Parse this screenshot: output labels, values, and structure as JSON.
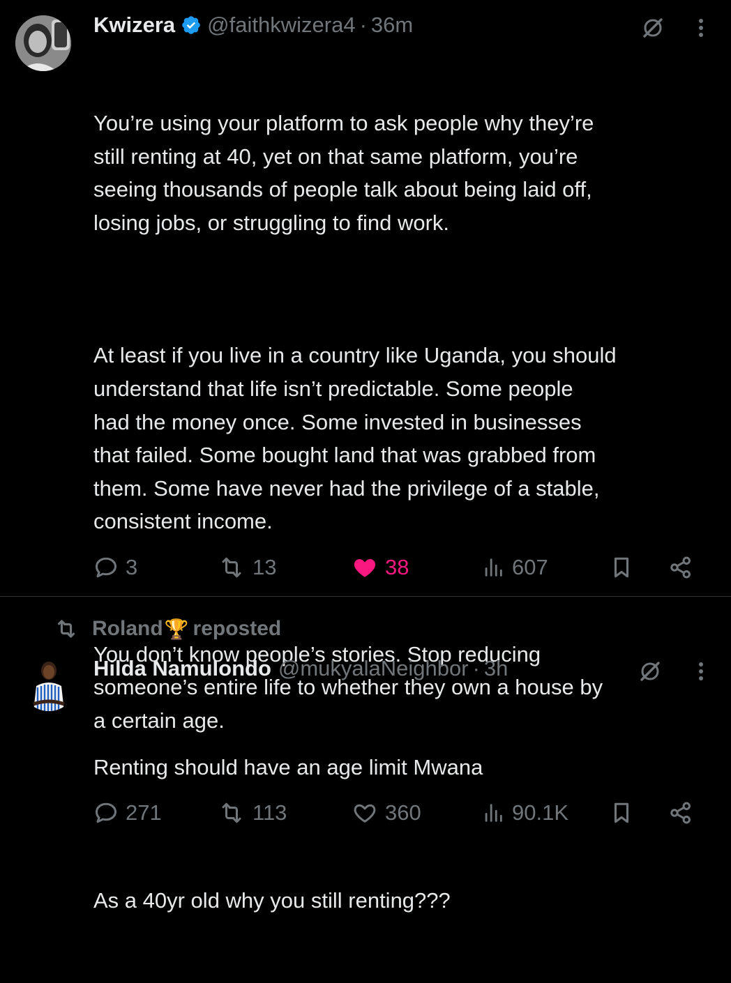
{
  "tweet1": {
    "display_name": "Kwizera",
    "handle": "@faithkwizera4",
    "separator": "·",
    "time": "36m",
    "paragraphs": [
      "You’re using your platform to ask people why they’re\nstill renting at 40, yet on that same platform, you’re\nseeing thousands of people talk about being laid off,\nlosing jobs, or struggling to find work.",
      "At least if you live in a country like Uganda, you should\nunderstand that life isn’t predictable. Some people\nhad the money once. Some invested in businesses\nthat failed. Some bought land that was grabbed from\nthem. Some have never had the privilege of a stable,\nconsistent income.",
      "You don’t know people’s stories. Stop reducing\nsomeone’s entire life to whether they own a house by\na certain age."
    ],
    "replies": "3",
    "reposts": "13",
    "likes": "38",
    "views": "607",
    "liked": true
  },
  "repost_context": {
    "user": "Roland",
    "emoji": "🏆",
    "label": "reposted"
  },
  "tweet2": {
    "display_name": "Hilda Namulondo",
    "handle": "@mukyalaNeighbor",
    "separator": "·",
    "time": "3h",
    "paragraphs": [
      "Renting should have an age limit Mwana",
      "As a 40yr old why you still renting???"
    ],
    "replies": "271",
    "reposts": "113",
    "likes": "360",
    "views": "90.1K",
    "liked": false
  },
  "icons": {
    "verified": "verified-badge-icon",
    "grok": "grok-icon",
    "more": "more-dots-icon",
    "reply": "reply-bubble-icon",
    "repost": "repost-arrows-icon",
    "like": "heart-icon",
    "views": "views-bars-icon",
    "bookmark": "bookmark-icon",
    "share": "share-icon"
  },
  "colors": {
    "background": "#000000",
    "text_primary": "#e7e9ea",
    "text_secondary": "#71767b",
    "like_active": "#f91880",
    "verified_blue": "#1d9bf0",
    "divider": "#2f3336"
  }
}
